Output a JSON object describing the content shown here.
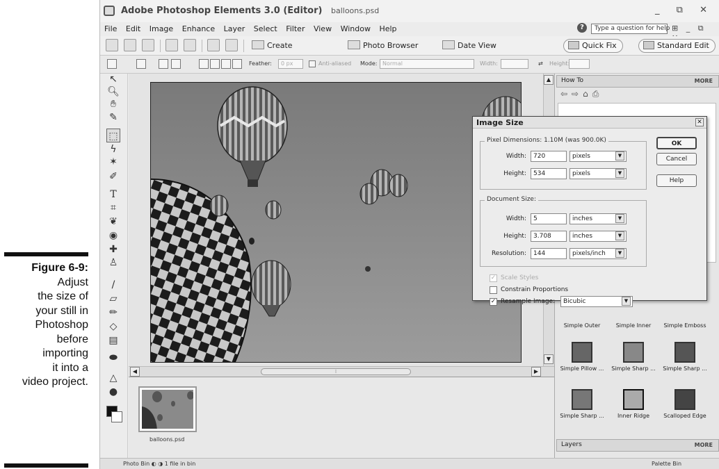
{
  "caption": {
    "figure": "Figure 6-9:",
    "lines": [
      "Adjust",
      "the size of",
      "your still in",
      "Photoshop",
      "before",
      "importing",
      "it into a",
      "video project."
    ]
  },
  "window": {
    "title": "Adobe Photoshop Elements 3.0 (Editor)",
    "document": "balloons.psd",
    "controls": "_ ⧉ ✕"
  },
  "menu": {
    "items": [
      "File",
      "Edit",
      "Image",
      "Enhance",
      "Layer",
      "Select",
      "Filter",
      "View",
      "Window",
      "Help"
    ],
    "help_placeholder": "Type a question for help",
    "right_controls": "⊞ _ ⧉ ✕"
  },
  "shortcuts": {
    "create": "Create",
    "photo_browser": "Photo Browser",
    "date_view": "Date View",
    "quick_fix": "Quick Fix",
    "standard_edit": "Standard Edit"
  },
  "options": {
    "feather_label": "Feather:",
    "feather_value": "0 px",
    "anti_aliased": "Anti-aliased",
    "mode_label": "Mode:",
    "mode_value": "Normal",
    "width_label": "Width:",
    "height_label": "Height:"
  },
  "photobin": {
    "file": "balloons.psd",
    "status_left": "Photo Bin  ◐  ◑  1 file in bin",
    "status_right": "Palette Bin"
  },
  "palette": {
    "howto": "How To",
    "more": "MORE",
    "layers": "Layers",
    "styles": [
      "Simple Outer",
      "Simple Inner",
      "Simple Emboss",
      "Simple Pillow ...",
      "Simple Sharp ...",
      "Simple Sharp ...",
      "Simple Sharp ...",
      "Inner Ridge",
      "Scalloped Edge"
    ]
  },
  "dialog": {
    "title": "Image Size",
    "pixel_dims": "Pixel Dimensions:  1.10M (was 900.0K)",
    "width_label": "Width:",
    "width_value": "720",
    "width_unit": "pixels",
    "height_label": "Height:",
    "height_value": "534",
    "height_unit": "pixels",
    "doc_size": "Document Size:",
    "doc_width_label": "Width:",
    "doc_width_value": "5",
    "doc_width_unit": "inches",
    "doc_height_label": "Height:",
    "doc_height_value": "3.708",
    "doc_height_unit": "inches",
    "resolution_label": "Resolution:",
    "resolution_value": "144",
    "resolution_unit": "pixels/inch",
    "scale_styles": "Scale Styles",
    "scale_styles_checked": true,
    "constrain": "Constrain Proportions",
    "constrain_checked": false,
    "resample": "Resample Image:",
    "resample_checked": true,
    "resample_value": "Bicubic",
    "ok": "OK",
    "cancel": "Cancel",
    "help": "Help"
  }
}
